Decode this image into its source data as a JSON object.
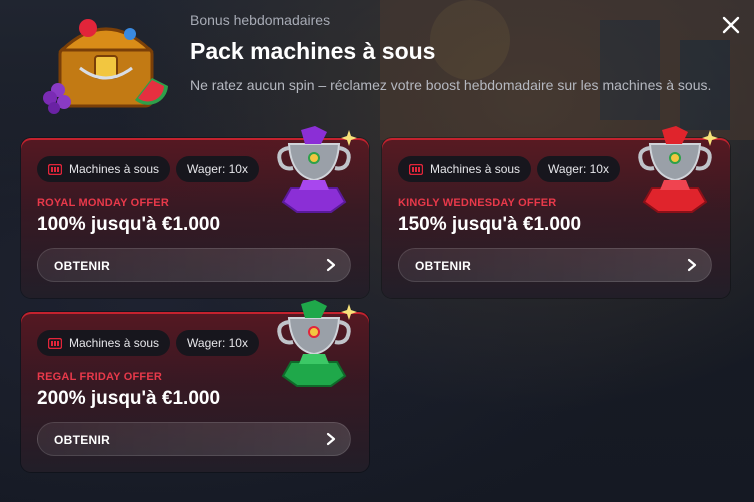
{
  "header": {
    "subtitle": "Bonus hebdomadaires",
    "title": "Pack machines à sous",
    "description": "Ne ratez aucun spin – réclamez votre boost hebdomadaire sur les machines à sous."
  },
  "offers": [
    {
      "category": "Machines à sous",
      "wager": "Wager: 10x",
      "name": "ROYAL MONDAY OFFER",
      "amount": "100% jusqu'à €1.000",
      "button": "OBTENIR",
      "gem_color": "#8b2fd6"
    },
    {
      "category": "Machines à sous",
      "wager": "Wager: 10x",
      "name": "KINGLY WEDNESDAY OFFER",
      "amount": "150% jusqu'à €1.000",
      "button": "OBTENIR",
      "gem_color": "#e0242c"
    },
    {
      "category": "Machines à sous",
      "wager": "Wager: 10x",
      "name": "REGAL FRIDAY OFFER",
      "amount": "200% jusqu'à €1.000",
      "button": "OBTENIR",
      "gem_color": "#1fa84a"
    }
  ],
  "colors": {
    "accent_red": "#e8394a"
  },
  "icons": {
    "close": "close-icon",
    "slot": "slot-machine-icon",
    "chevron": "chevron-right-icon"
  }
}
